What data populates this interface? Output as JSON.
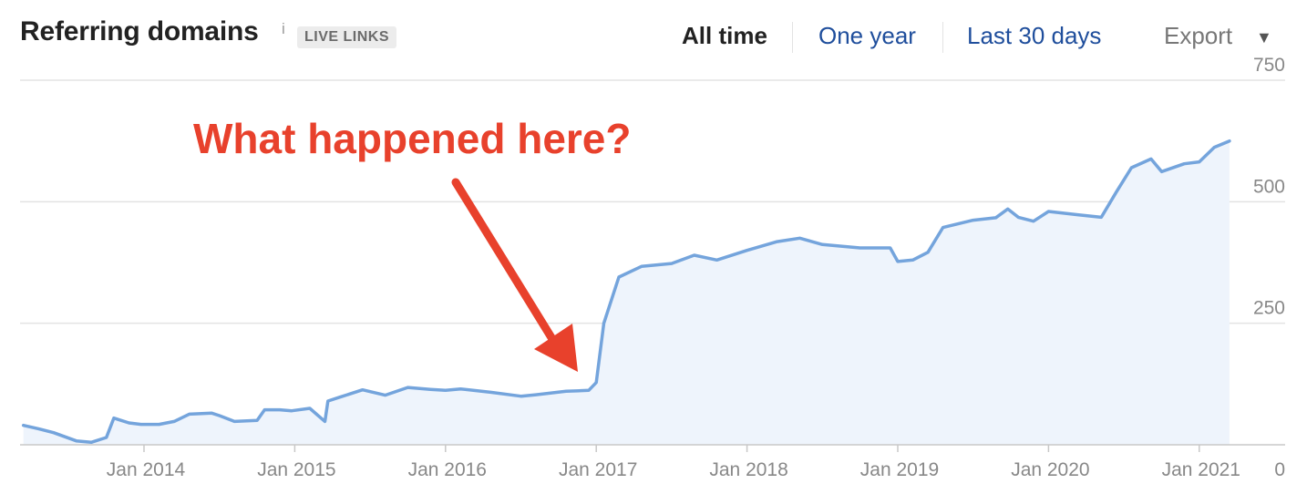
{
  "header": {
    "title": "Referring domains",
    "info_icon": "i",
    "badge": "LIVE LINKS",
    "ranges": [
      {
        "label": "All time",
        "active": true
      },
      {
        "label": "One year",
        "active": false
      },
      {
        "label": "Last 30 days",
        "active": false
      }
    ],
    "export_label": "Export",
    "export_caret": "▼"
  },
  "annotation": {
    "text": "What happened here?",
    "color": "#e8412c"
  },
  "colors": {
    "line": "#74a4dc",
    "fill": "#eef4fc",
    "grid": "#e3e3e3",
    "axis": "#c8c8c8",
    "tick": "#888888"
  },
  "chart_data": {
    "type": "area",
    "title": "Referring domains",
    "ylim": [
      0,
      750
    ],
    "yticks": [
      0,
      250,
      500,
      750
    ],
    "xlim": [
      2013.2,
      2021.25
    ],
    "x_ticks": [
      {
        "label": "Jan 2014",
        "x": 2014
      },
      {
        "label": "Jan 2015",
        "x": 2015
      },
      {
        "label": "Jan 2016",
        "x": 2016
      },
      {
        "label": "Jan 2017",
        "x": 2017
      },
      {
        "label": "Jan 2018",
        "x": 2018
      },
      {
        "label": "Jan 2019",
        "x": 2019
      },
      {
        "label": "Jan 2020",
        "x": 2020
      },
      {
        "label": "Jan 2021",
        "x": 2021
      }
    ],
    "grid": true,
    "series": [
      {
        "x": [
          2013.2,
          2013.3,
          2013.4,
          2013.55,
          2013.65,
          2013.75,
          2013.8,
          2013.9,
          2013.98,
          2014.1,
          2014.2,
          2014.3,
          2014.45,
          2014.5,
          2014.6,
          2014.75,
          2014.8,
          2014.9,
          2014.98,
          2015.1,
          2015.2,
          2015.22,
          2015.3,
          2015.45,
          2015.6,
          2015.75,
          2015.9,
          2016.0,
          2016.1,
          2016.3,
          2016.5,
          2016.6,
          2016.8,
          2016.95,
          2017.0,
          2017.05,
          2017.15,
          2017.3,
          2017.5,
          2017.65,
          2017.8,
          2018.0,
          2018.2,
          2018.35,
          2018.5,
          2018.75,
          2018.95,
          2019.0,
          2019.1,
          2019.2,
          2019.3,
          2019.5,
          2019.65,
          2019.73,
          2019.8,
          2019.9,
          2020.0,
          2020.2,
          2020.35,
          2020.45,
          2020.55,
          2020.68,
          2020.75,
          2020.9,
          2021.0,
          2021.1,
          2021.2
        ],
        "y": [
          40,
          33,
          25,
          8,
          5,
          15,
          55,
          45,
          42,
          42,
          48,
          63,
          65,
          60,
          48,
          50,
          72,
          72,
          70,
          75,
          48,
          90,
          98,
          113,
          102,
          118,
          114,
          112,
          115,
          108,
          100,
          103,
          110,
          112,
          128,
          250,
          345,
          367,
          373,
          390,
          380,
          400,
          418,
          425,
          412,
          405,
          405,
          377,
          380,
          396,
          447,
          462,
          467,
          485,
          468,
          460,
          480,
          473,
          468,
          520,
          570,
          588,
          562,
          578,
          582,
          612,
          625
        ]
      }
    ]
  }
}
